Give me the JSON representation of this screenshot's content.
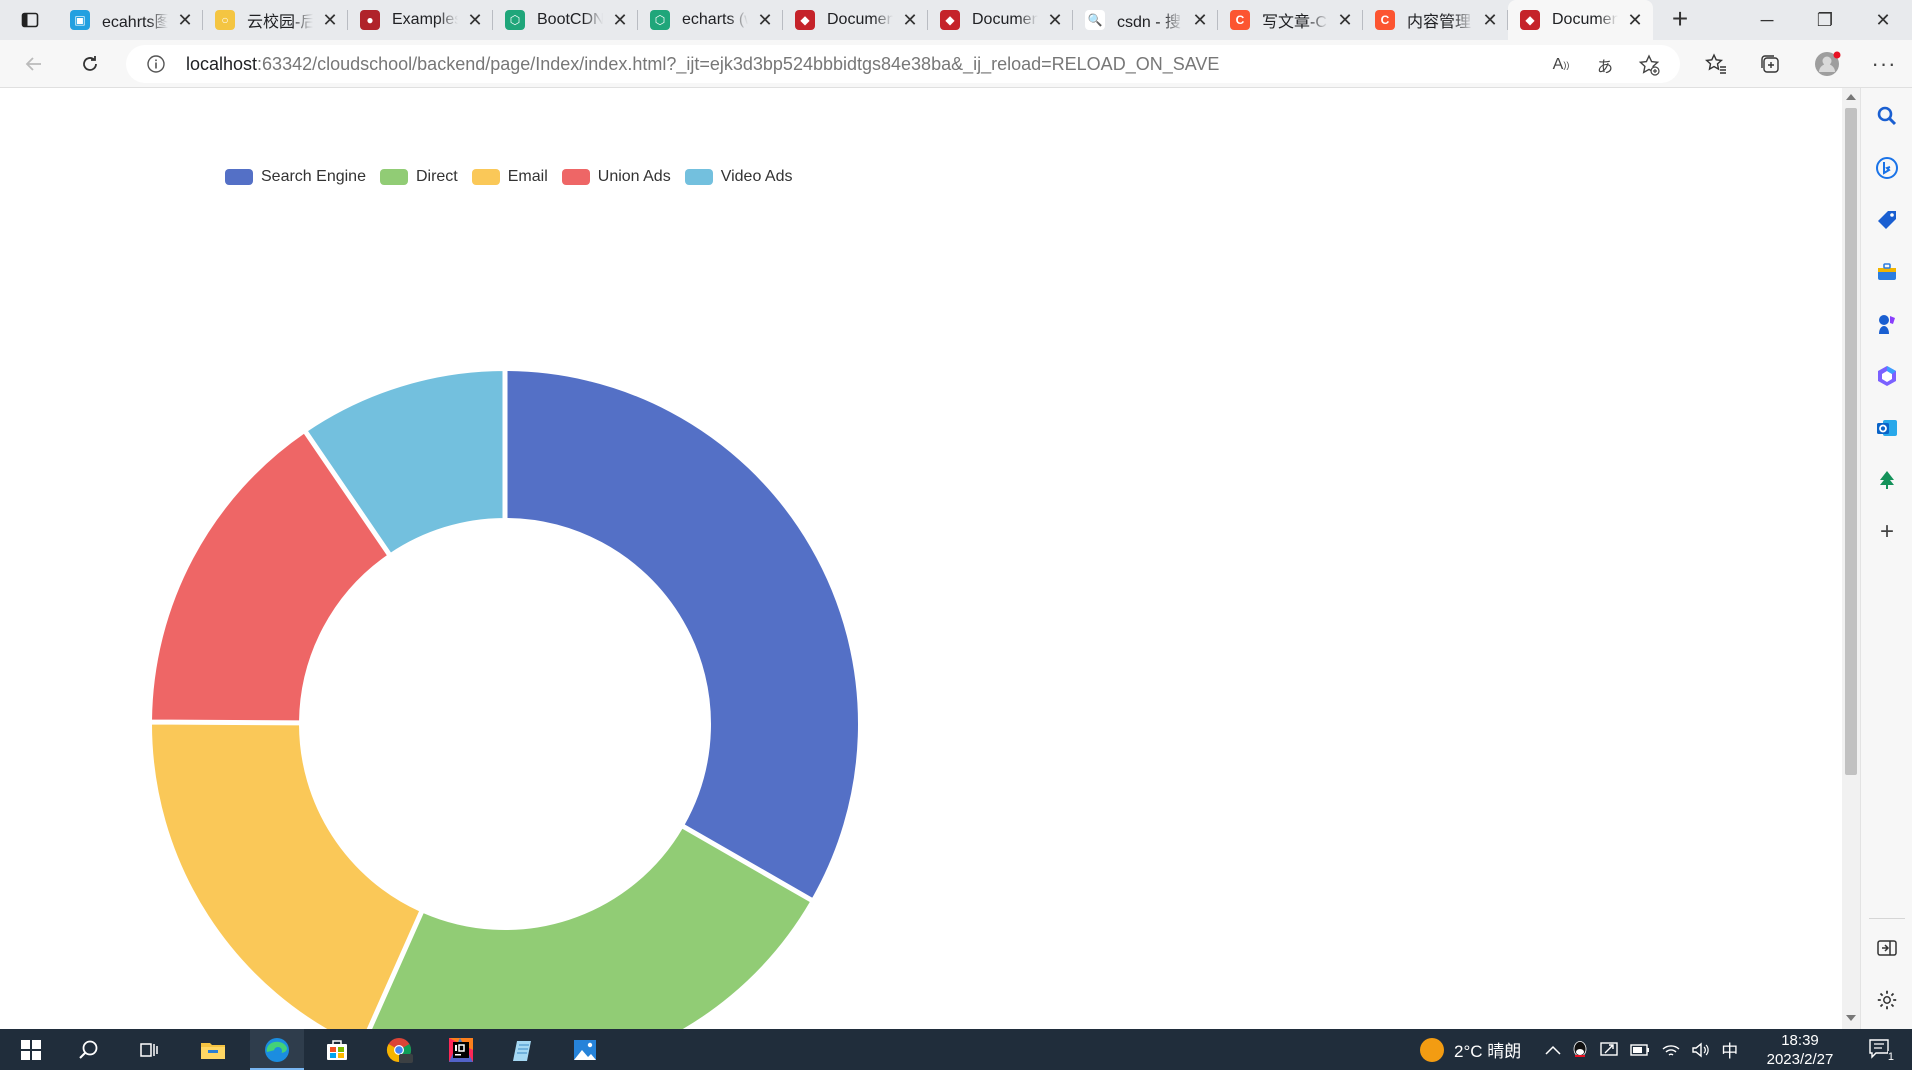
{
  "browser": {
    "tabs": [
      {
        "title": "ecahrts图",
        "favicon_color": "#23a0e0",
        "favicon_glyph": "▣",
        "favicon_name": "bilibili-icon"
      },
      {
        "title": "云校园-后",
        "favicon_color": "#f4c542",
        "favicon_glyph": "○",
        "favicon_name": "globe-icon"
      },
      {
        "title": "Examples",
        "favicon_color": "#b0232a",
        "favicon_glyph": "●",
        "favicon_name": "echarts-icon"
      },
      {
        "title": "BootCDN",
        "favicon_color": "#1fa67a",
        "favicon_glyph": "⬡",
        "favicon_name": "bootcdn-icon"
      },
      {
        "title": "echarts (w",
        "favicon_color": "#1fa67a",
        "favicon_glyph": "⬡",
        "favicon_name": "bootcdn-icon"
      },
      {
        "title": "Documen",
        "favicon_color": "#c5232a",
        "favicon_glyph": "◆",
        "favicon_name": "jetbrains-icon"
      },
      {
        "title": "Documen",
        "favicon_color": "#c5232a",
        "favicon_glyph": "◆",
        "favicon_name": "jetbrains-icon"
      },
      {
        "title": "csdn - 搜",
        "favicon_color": "#ffffff",
        "favicon_glyph": "🔍",
        "favicon_name": "search-icon"
      },
      {
        "title": "写文章-C",
        "favicon_color": "#fc5531",
        "favicon_glyph": "C",
        "favicon_name": "csdn-icon"
      },
      {
        "title": "内容管理",
        "favicon_color": "#fc5531",
        "favicon_glyph": "C",
        "favicon_name": "csdn-icon"
      },
      {
        "title": "Documen",
        "favicon_color": "#c5232a",
        "favicon_glyph": "◆",
        "favicon_name": "jetbrains-icon",
        "active": true
      }
    ],
    "address": {
      "host": "localhost",
      "rest": ":63342/cloudschool/backend/page/Index/index.html?_ijt=ejk3d3bp524bbbidtgs84e38ba&_ij_reload=RELOAD_ON_SAVE"
    }
  },
  "chart_data": {
    "type": "pie",
    "donut": true,
    "legend_position": "top-left",
    "series": [
      {
        "name": "Search Engine",
        "value": 1048,
        "color": "#5470c6"
      },
      {
        "name": "Direct",
        "value": 735,
        "color": "#91cc75"
      },
      {
        "name": "Email",
        "value": 580,
        "color": "#fac858"
      },
      {
        "name": "Union Ads",
        "value": 484,
        "color": "#ee6666"
      },
      {
        "name": "Video Ads",
        "value": 300,
        "color": "#73c0de"
      }
    ]
  },
  "taskbar": {
    "weather": "2°C 晴朗",
    "ime": "中",
    "time": "18:39",
    "date": "2023/2/27",
    "notification_count": "1"
  }
}
